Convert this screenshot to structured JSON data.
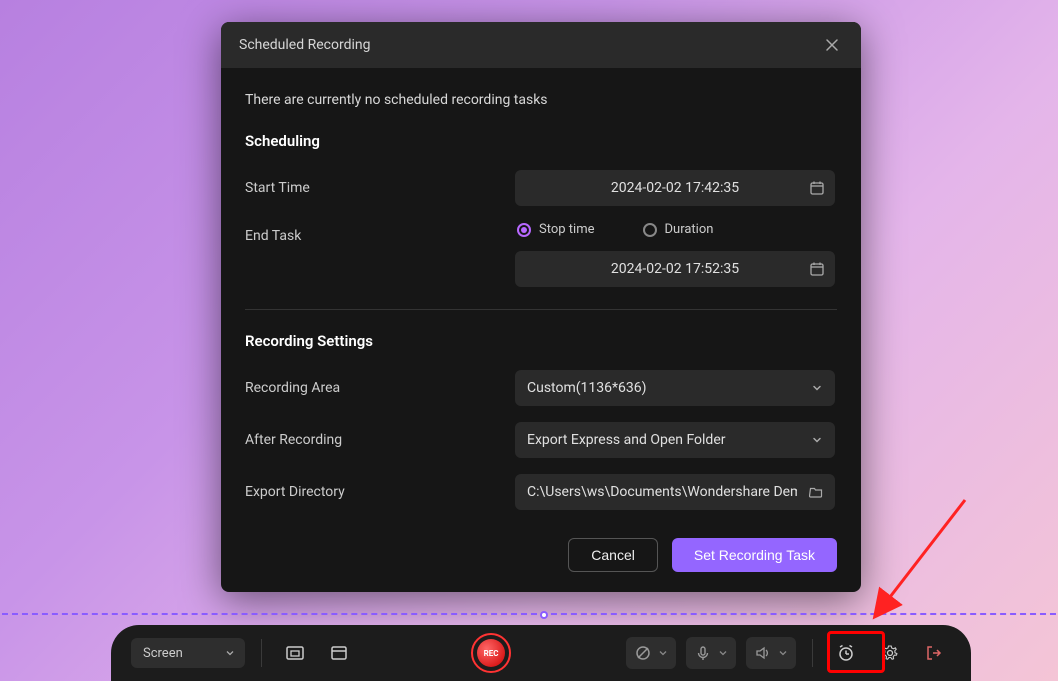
{
  "dialog": {
    "title": "Scheduled Recording",
    "info": "There are currently no scheduled recording tasks",
    "scheduling_heading": "Scheduling",
    "start_time_label": "Start Time",
    "start_time_value": "2024-02-02 17:42:35",
    "end_task_label": "End Task",
    "radio_stop": "Stop time",
    "radio_duration": "Duration",
    "end_time_value": "2024-02-02 17:52:35",
    "recording_settings_heading": "Recording Settings",
    "recording_area_label": "Recording Area",
    "recording_area_value": "Custom(1136*636)",
    "after_recording_label": "After Recording",
    "after_recording_value": "Export Express and Open Folder",
    "export_dir_label": "Export Directory",
    "export_dir_value": "C:\\Users\\ws\\Documents\\Wondershare Dem",
    "cancel": "Cancel",
    "set_task": "Set Recording Task"
  },
  "toolbar": {
    "screen_label": "Screen",
    "rec_label": "REC"
  }
}
